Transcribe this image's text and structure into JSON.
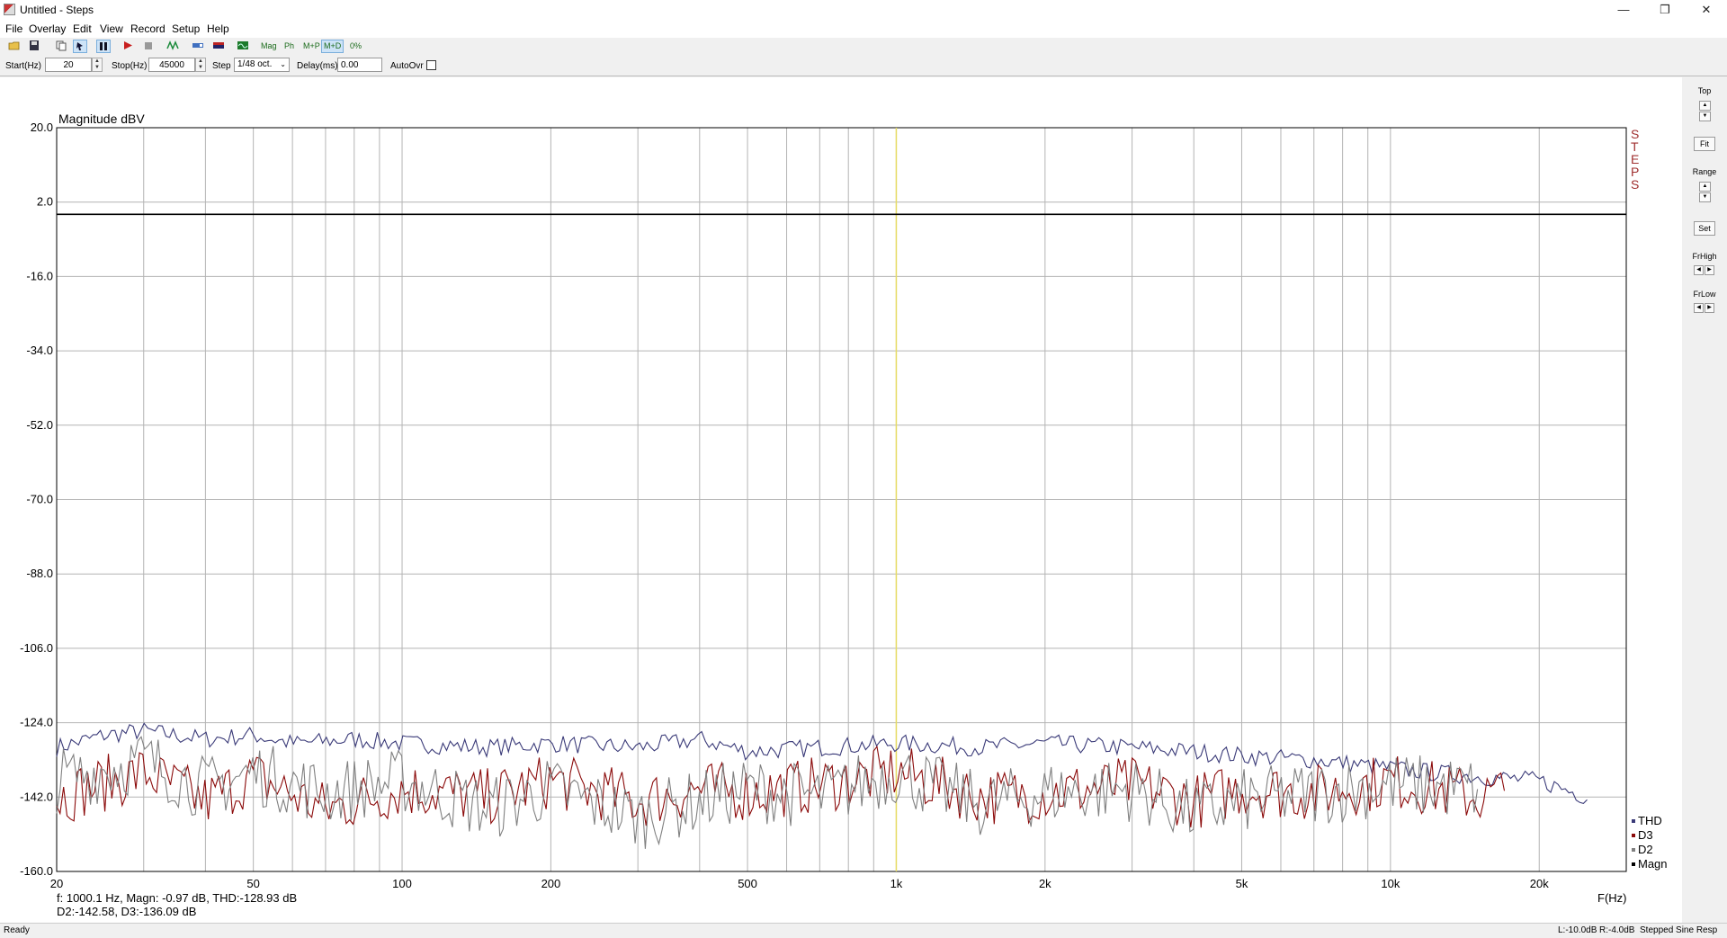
{
  "window": {
    "title": "Untitled - Steps",
    "min": "—",
    "max": "❐",
    "close": "✕"
  },
  "menu": [
    "File",
    "Overlay",
    "Edit",
    "View",
    "Record",
    "Setup",
    "Help"
  ],
  "toolbar": {
    "mag": "Mag",
    "ph": "Ph",
    "mp": "M+P",
    "md": "M+D",
    "pct": "0%"
  },
  "params": {
    "start_label": "Start(Hz)",
    "start_value": "20",
    "stop_label": "Stop(Hz)",
    "stop_value": "45000",
    "step_label": "Step",
    "step_value": "1/48 oct.",
    "delay_label": "Delay(ms)",
    "delay_value": "0.00",
    "autoovr_label": "AutoOvr"
  },
  "right_panel": {
    "top": "Top",
    "fit": "Fit",
    "range": "Range",
    "set": "Set",
    "frhigh": "FrHigh",
    "frlow": "FrLow"
  },
  "readout": {
    "line1": "f: 1000.1 Hz, Magn: -0.97 dB, THD:-128.93  dB",
    "line2": "D2:-142.58, D3:-136.09 dB"
  },
  "status": {
    "left": "Ready",
    "l_level": "L:-10.0dB",
    "r_level": "R:-4.0dB",
    "mode": "Stepped Sine Resp"
  },
  "colors": {
    "magn": "#000000",
    "thd": "#3a3a78",
    "d3": "#8b0a0a",
    "d2": "#808080",
    "cursor": "#e6dc64",
    "grid": "#b4b4b4",
    "steps_label": "#a03030"
  },
  "chart_data": {
    "type": "line",
    "title": "Magnitude dBV",
    "xlabel": "F(Hz)",
    "ylabel": "Magnitude dBV",
    "x_scale": "log",
    "xlim": [
      20,
      30000
    ],
    "ylim": [
      -160,
      20
    ],
    "y_ticks": [
      "20.0",
      "2.0",
      "-16.0",
      "-34.0",
      "-52.0",
      "-70.0",
      "-88.0",
      "-106.0",
      "-124.0",
      "-142.0",
      "-160.0"
    ],
    "x_ticks": [
      {
        "v": 20,
        "label": "20"
      },
      {
        "v": 50,
        "label": "50"
      },
      {
        "v": 100,
        "label": "100"
      },
      {
        "v": 200,
        "label": "200"
      },
      {
        "v": 500,
        "label": "500"
      },
      {
        "v": 1000,
        "label": "1k"
      },
      {
        "v": 2000,
        "label": "2k"
      },
      {
        "v": 5000,
        "label": "5k"
      },
      {
        "v": 10000,
        "label": "10k"
      },
      {
        "v": 20000,
        "label": "20k"
      }
    ],
    "side_label": [
      "S",
      "T",
      "E",
      "P",
      "S"
    ],
    "cursor_x": 1000,
    "legend": [
      "THD",
      "D3",
      "D2",
      "Magn"
    ],
    "series": [
      {
        "name": "Magn",
        "x": [
          20,
          30000
        ],
        "values": [
          -0.97,
          -0.97
        ]
      },
      {
        "name": "THD",
        "x": [
          20,
          25,
          30,
          40,
          50,
          60,
          80,
          100,
          150,
          200,
          300,
          400,
          500,
          700,
          1000,
          1500,
          2000,
          3000,
          4000,
          5000,
          7000,
          10000,
          12000,
          15000,
          20000,
          25000
        ],
        "values": [
          -130,
          -127,
          -126,
          -128,
          -127,
          -129,
          -128,
          -129,
          -130,
          -129,
          -130,
          -128,
          -131,
          -130,
          -129,
          -130,
          -129,
          -130,
          -131,
          -132,
          -133,
          -135,
          -136,
          -137,
          -138,
          -142
        ]
      },
      {
        "name": "D3",
        "x": [
          20,
          30,
          40,
          50,
          70,
          100,
          150,
          200,
          300,
          400,
          500,
          700,
          1000,
          1500,
          2000,
          3000,
          4000,
          5000,
          7000,
          10000,
          15000,
          17000
        ],
        "values": [
          -142,
          -136,
          -143,
          -137,
          -145,
          -140,
          -142,
          -138,
          -143,
          -140,
          -141,
          -139,
          -136,
          -142,
          -141,
          -139,
          -143,
          -140,
          -141,
          -138,
          -142,
          -141
        ]
      },
      {
        "name": "D2",
        "x": [
          20,
          30,
          40,
          50,
          70,
          100,
          150,
          200,
          300,
          400,
          500,
          700,
          1000,
          1500,
          2000,
          3000,
          4000,
          5000,
          7000,
          10000,
          15000
        ],
        "values": [
          -138,
          -133,
          -140,
          -136,
          -141,
          -138,
          -145,
          -140,
          -147,
          -143,
          -140,
          -142,
          -136,
          -144,
          -141,
          -140,
          -146,
          -143,
          -141,
          -139,
          -140
        ]
      }
    ]
  }
}
